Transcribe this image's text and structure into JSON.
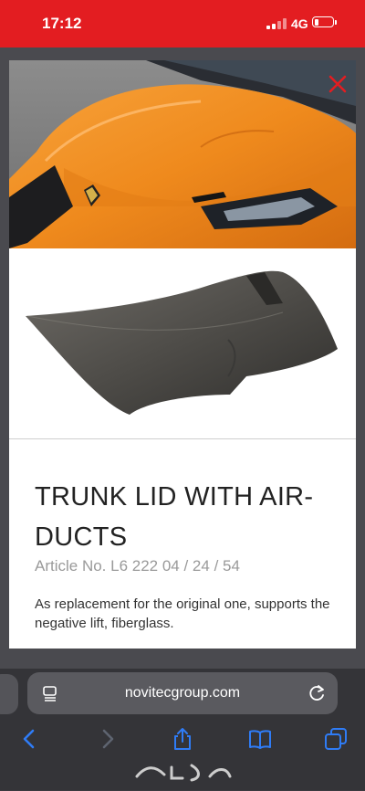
{
  "status_bar": {
    "time": "17:12",
    "network": "4G"
  },
  "modal": {
    "title": "TRUNK LID WITH AIR-DUCTS",
    "article": "Article No. L6 222 04 / 24 / 54",
    "description": "As replacement for the original one, supports the negative lift, fiberglass."
  },
  "browser": {
    "url": "novitecgroup.com"
  },
  "colors": {
    "status_bar": "#e31d21",
    "close_icon": "#e31d21",
    "toolbar_icon": "#2f7cf6",
    "car_orange": "#f08a1c"
  },
  "icons": [
    "signal-icon",
    "battery-icon",
    "close-icon",
    "page-menu-icon",
    "reload-icon",
    "back-icon",
    "forward-icon",
    "share-icon",
    "bookmarks-icon",
    "tabs-icon"
  ]
}
